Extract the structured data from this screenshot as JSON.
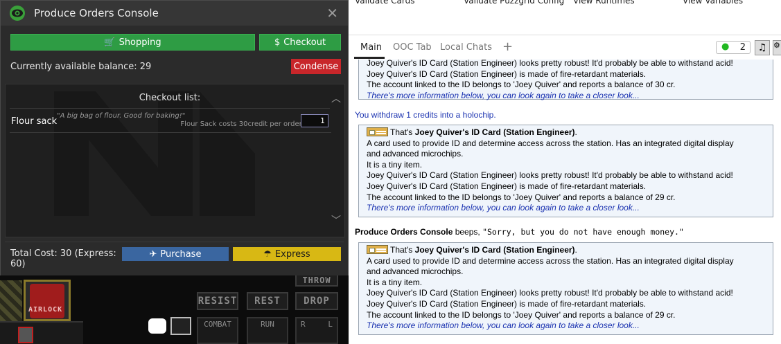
{
  "console": {
    "title": "Produce Orders Console",
    "shopping_label": "Shopping",
    "checkout_label": "Checkout",
    "balance_text": "Currently available balance: 29",
    "condense_label": "Condense",
    "list_title": "Checkout list:",
    "items": [
      {
        "name": "Flour sack",
        "desc": "\"A big bag of flour. Good for baking!\"",
        "cost": "Flour Sack costs 30credit per order.",
        "qty": "1"
      }
    ],
    "total_text": "Total Cost: 30 (Express: 60)",
    "purchase_label": "Purchase",
    "express_label": "Express"
  },
  "hud": {
    "airlock_label": "AIRLOCK",
    "throw_label": "THROW",
    "resist_label": "RESIST",
    "rest_label": "REST",
    "drop_label": "DROP",
    "combat_label": "COMBAT",
    "run_label": "RUN",
    "rl_left": "R",
    "rl_right": "L"
  },
  "menu": {
    "items": [
      "Validate Cards",
      "Validate Puzzgrid Config",
      "View Runtimes",
      "View Variables"
    ]
  },
  "tabs": {
    "items": [
      "Main",
      "OOC Tab",
      "Local Chats"
    ],
    "add_label": "+",
    "counter_value": "2",
    "counter_dot": "●",
    "note_icon": "♫",
    "gear_icon": "⚙"
  },
  "chat": {
    "more_text": "There's more information below, you can look again to take a closer look...",
    "box1": {
      "line1": "Joey Quiver's ID Card (Station Engineer) looks pretty robust! It'd probably be able to withstand acid!",
      "line2": "Joey Quiver's ID Card (Station Engineer) is made of fire-retardant materials.",
      "line3": "The account linked to the ID belongs to 'Joey Quiver' and reports a balance of 30 cr."
    },
    "withdraw_msg": "You withdraw 1 credits into a holochip.",
    "card": {
      "thats": "That's ",
      "name": "Joey Quiver's ID Card (Station Engineer)",
      "period": ".",
      "desc1": "A card used to provide ID and determine access across the station. Has an integrated digital display",
      "desc2": "and advanced microchips.",
      "size": "It is a tiny item.",
      "robust": "Joey Quiver's ID Card (Station Engineer) looks pretty robust! It'd probably be able to withstand acid!",
      "fire": "Joey Quiver's ID Card (Station Engineer) is made of fire-retardant materials.",
      "account": "The account linked to the ID belongs to 'Joey Quiver' and reports a balance of 29 cr."
    },
    "beep": {
      "source": "Produce Orders Console",
      "verb": " beeps, ",
      "speech": "\"Sorry, but you do not have enough money.\""
    }
  },
  "colors": {
    "green": "#2e9c44",
    "red": "#c8262a",
    "blue": "#3a66a0",
    "yellow": "#d8b814",
    "link_blue": "#1a32b0"
  }
}
